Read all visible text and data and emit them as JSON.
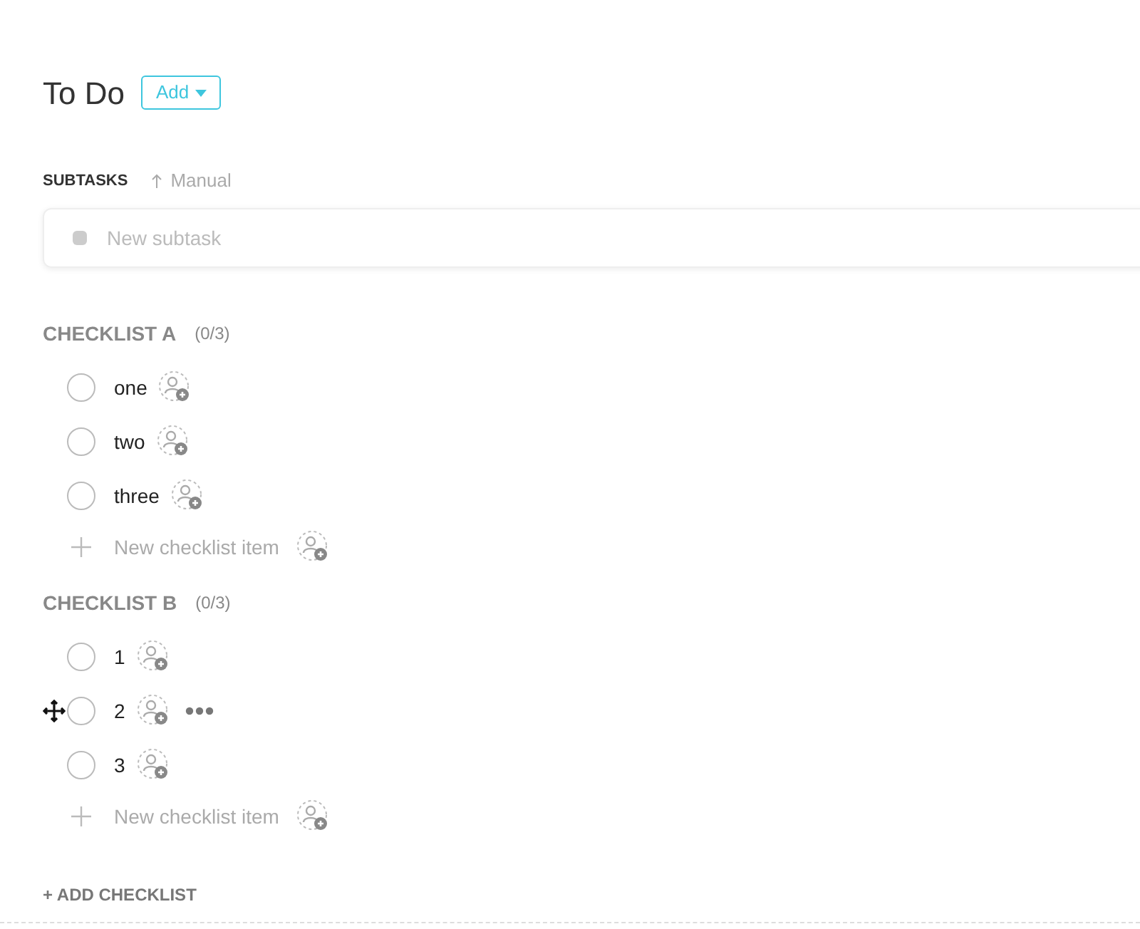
{
  "title": "To Do",
  "add_button": {
    "label": "Add"
  },
  "subtasks": {
    "label": "SUBTASKS",
    "sort": "Manual",
    "new_placeholder": "New subtask"
  },
  "checklists": [
    {
      "name": "CHECKLIST A",
      "count": "(0/3)",
      "new_item_placeholder": "New checklist item",
      "items": [
        {
          "label": "one",
          "checked": false,
          "hovered": false
        },
        {
          "label": "two",
          "checked": false,
          "hovered": false
        },
        {
          "label": "three",
          "checked": false,
          "hovered": false
        }
      ]
    },
    {
      "name": "CHECKLIST B",
      "count": "(0/3)",
      "new_item_placeholder": "New checklist item",
      "items": [
        {
          "label": "1",
          "checked": false,
          "hovered": false
        },
        {
          "label": "2",
          "checked": false,
          "hovered": true
        },
        {
          "label": "3",
          "checked": false,
          "hovered": false
        }
      ]
    }
  ],
  "add_checklist": "+ ADD CHECKLIST"
}
